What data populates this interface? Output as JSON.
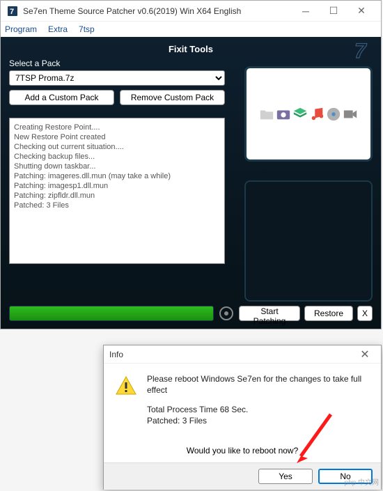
{
  "window": {
    "title": "Se7en Theme Source Patcher v0.6(2019) Win X64 English",
    "menu": {
      "program": "Program",
      "extra": "Extra",
      "7tsp": "7tsp"
    }
  },
  "fixit_header": "Fixit Tools",
  "select_pack_label": "Select a Pack",
  "pack_select": {
    "value": "7TSP Proma.7z"
  },
  "buttons": {
    "add_pack": "Add a Custom Pack",
    "remove_pack": "Remove Custom Pack",
    "start": "Start Patching",
    "restore": "Restore",
    "x": "X"
  },
  "log_lines": [
    "Creating Restore Point....",
    "New Restore Point created",
    "",
    "",
    "Checking out current situation....",
    "",
    "Checking backup files...",
    "",
    "Shutting down taskbar...",
    "",
    "Patching: imageres.dll.mun (may take a while)",
    "Patching: imagesp1.dll.mun",
    "Patching: zipfldr.dll.mun",
    "Patched: 3 Files"
  ],
  "progress": {
    "percent": 100
  },
  "dialog": {
    "title": "Info",
    "msg1": "Please reboot Windows Se7en for the changes to take full effect",
    "msg2a": "Total Process Time 68 Sec.",
    "msg2b": "Patched: 3 Files",
    "prompt": "Would you like to reboot now?",
    "yes": "Yes",
    "no": "No"
  },
  "watermark": "php 中文网"
}
